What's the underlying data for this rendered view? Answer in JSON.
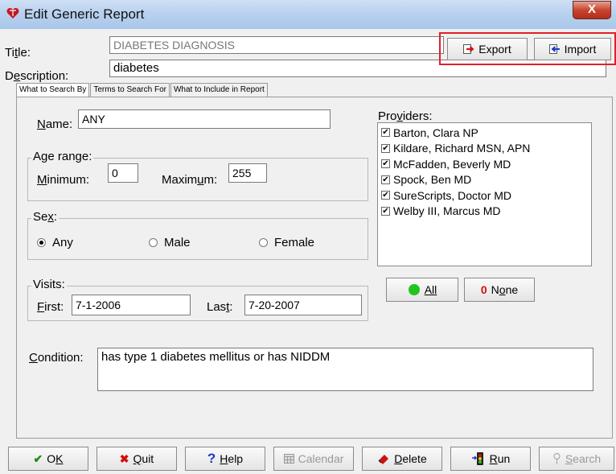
{
  "window": {
    "title": "Edit Generic Report",
    "close": "X"
  },
  "fields": {
    "title_label": "Title:",
    "title_value": "DIABETES DIAGNOSIS",
    "description_label": "Description:",
    "description_value": "diabetes"
  },
  "top_buttons": {
    "export": "Export",
    "import": "Import"
  },
  "tabs": [
    {
      "label": "What to Search By",
      "active": true
    },
    {
      "label": "Terms to Search For",
      "active": false
    },
    {
      "label": "What to Include in Report",
      "active": false
    }
  ],
  "search": {
    "name_label": "Name:",
    "name_value": "ANY",
    "age_group": "Age range:",
    "min_label": "Minimum:",
    "min_value": "0",
    "max_label": "Maximum:",
    "max_value": "255",
    "sex_group": "Sex:",
    "sex_options": [
      "Any",
      "Male",
      "Female"
    ],
    "sex_selected": "Any",
    "visits_group": "Visits:",
    "first_label": "First:",
    "first_value": "7-1-2006",
    "last_label": "Last:",
    "last_value": "7-20-2007",
    "condition_label": "Condition:",
    "condition_value": "has type 1 diabetes mellitus or has NIDDM"
  },
  "providers": {
    "label": "Providers:",
    "items": [
      "Barton, Clara NP",
      "Kildare, Richard MSN, APN",
      "McFadden, Beverly MD",
      "Spock, Ben MD",
      "SureScripts, Doctor MD",
      "Welby III, Marcus MD"
    ],
    "all_label": "All",
    "none_label": "None"
  },
  "bottom_buttons": {
    "ok": "OK",
    "quit": "Quit",
    "help": "Help",
    "calendar": "Calendar",
    "delete": "Delete",
    "run": "Run",
    "search": "Search"
  },
  "colors": {
    "highlight": "#e0202a",
    "green": "#22c41e",
    "red": "#d01010",
    "blue": "#1a3ccc"
  }
}
